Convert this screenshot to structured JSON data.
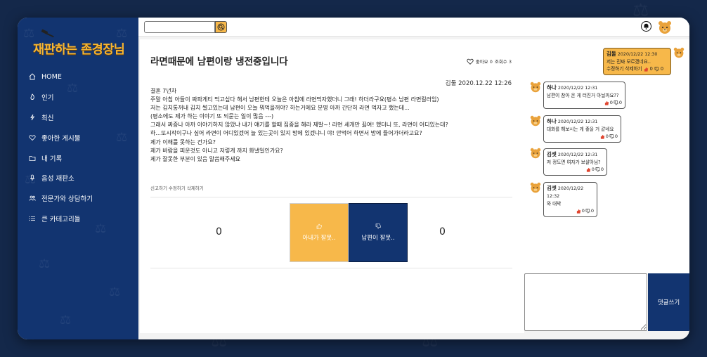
{
  "app": {
    "logo_text": "재판하는 존경장님"
  },
  "sidebar": {
    "items": [
      {
        "label": "HOME",
        "icon": "home-icon"
      },
      {
        "label": "인기",
        "icon": "fire-icon"
      },
      {
        "label": "최신",
        "icon": "bolt-icon"
      },
      {
        "label": "좋아한 게시물",
        "icon": "heart-icon"
      },
      {
        "label": "내 기록",
        "icon": "folder-icon"
      },
      {
        "label": "음성 재판소",
        "icon": "microphone-icon"
      },
      {
        "label": "전문가와 상담하기",
        "icon": "people-icon"
      },
      {
        "label": "큰 카테고리들",
        "icon": "list-icon"
      }
    ]
  },
  "topbar": {
    "search_value": "",
    "search_placeholder": ""
  },
  "post": {
    "title": "라면때문에 남편이랑 냉전중입니다",
    "likes_label": "좋아요 0",
    "views_label": "조회수 3",
    "author_date": "김둘 2020.12.22 12:26",
    "body": [
      "결혼 7년차",
      "주말 아침 아들이 짜파게티 먹고싶다 해서 남편한테 오늘은 아침에 라면먹자했더니 그래! 하더라구요(평소 남편 라면킬러임)",
      "저는 김치통꺼내 김치 썰고있는데 남편이 오늘 뭐먹을꺼야? 하는거에요 분명 아까 간단히 라면 먹자고 했는데...",
      "(평소에도 제가 하는 이야기 또 되묻는 일이 많음 ---)",
      "그래서 짜증나 아까 이야기하지 않았냐 내가 얘기를 할때 집중을 해라 제발~! 라면 세개만 끓여! 했더니 또, 라면이 어디있는대?",
      "하...또시작이구나 싶어 라면이 어디있겠어 늘 있는곳이 있지 방에 있겠냐니 야! 안먹어 하면서 방에 들어가더라고요?",
      "제가 이해를 못하는 건가요?",
      "제가 바람을 피운것도 아니고 저렇게 까지 화낼일인가요?",
      "제가 잘못한 부분이 있음 말씀해주세요"
    ],
    "actions": [
      "신고하기",
      "수정하기",
      "삭제하기"
    ],
    "vote_left_count": "0",
    "vote_right_count": "0",
    "vote_wife_label": "아내가 잘못..",
    "vote_husband_label": "남편이 잘못.."
  },
  "comments": [
    {
      "name": "김둘",
      "date": "2020/12/22 12:30",
      "text": "저는 진짜 모르겠네요..",
      "action_label": "수정하기 삭제하기",
      "likes": "0",
      "dislikes": "0",
      "mine": true
    },
    {
      "name": "하나",
      "date": "2020/12/22 12:31",
      "text": "남편이 참아 온 게 터진거 아닐까요??",
      "likes": "0",
      "dislikes": "0",
      "mine": false
    },
    {
      "name": "하나",
      "date": "2020/12/22 12:31",
      "text": "대화를 해보시는 게 좋을 거 같네요",
      "likes": "0",
      "dislikes": "0",
      "mine": false
    },
    {
      "name": "김셋",
      "date": "2020/12/22 12:31",
      "text": "저 정도면 여자가 보살아님?",
      "likes": "0",
      "dislikes": "0",
      "mine": false
    },
    {
      "name": "김셋",
      "date": "2020/12/22 12:32",
      "text": "와 대박",
      "likes": "0",
      "dislikes": "0",
      "mine": false
    }
  ],
  "comment_form": {
    "value": "",
    "submit_label": "댓글쓰기"
  },
  "colors": {
    "navy": "#123470",
    "accent": "#f7b84a",
    "background": "#14284a",
    "logo": "#f7b632"
  }
}
